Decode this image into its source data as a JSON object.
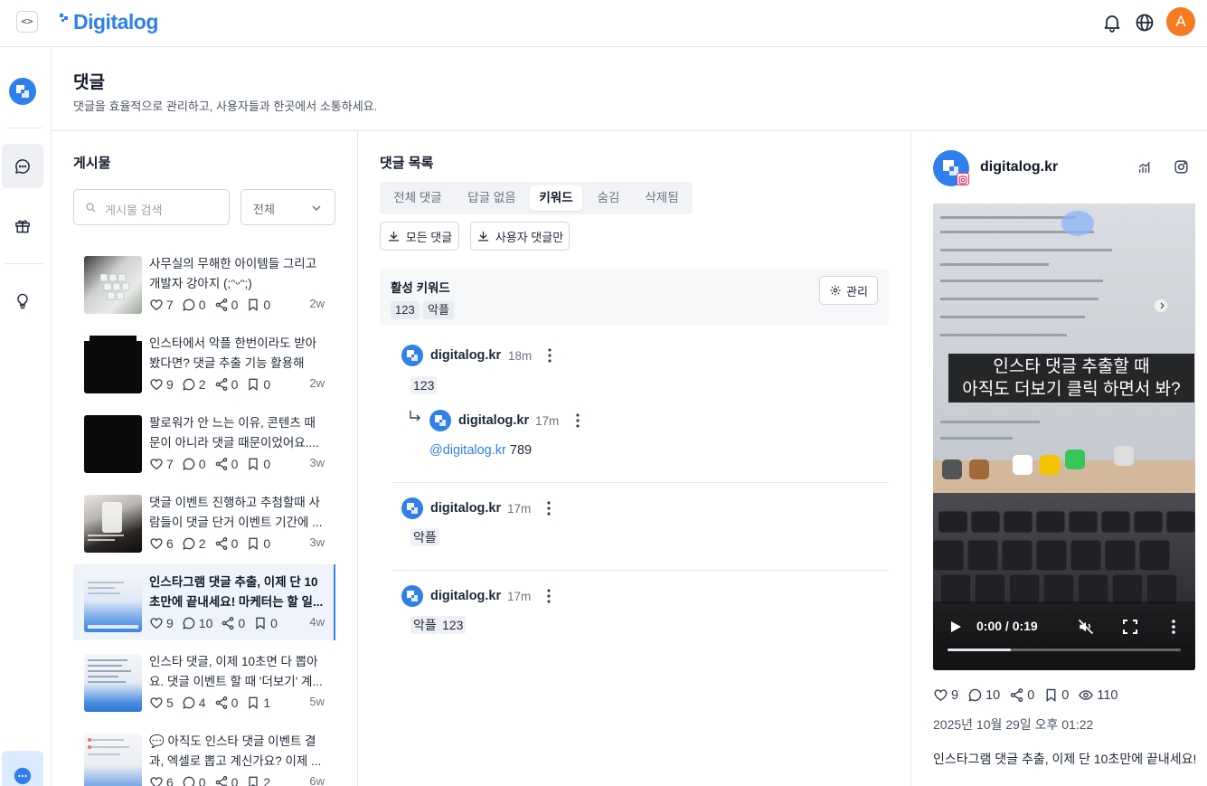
{
  "topbar": {
    "toggle_label": "<>",
    "logo_text": "Digitalog",
    "avatar_letter": "A",
    "icons": [
      "bell-icon",
      "globe-icon"
    ],
    "brand_color": "#2f80ed",
    "avatar_color": "#f47c20"
  },
  "rail": {
    "items": [
      "logo",
      "chat-icon",
      "gift-icon",
      "lightbulb-icon"
    ],
    "active": "chat-icon"
  },
  "page": {
    "title": "댓글",
    "subtitle": "댓글을 효율적으로 관리하고, 사용자들과 한곳에서 소통하세요."
  },
  "posts": {
    "title": "게시물",
    "search_placeholder": "게시물 검색",
    "filter_value": "전체",
    "items": [
      {
        "text": "사무실의 무해한 아이템들 그리고 개발자 강아지 (;ᵔᵕᵔ;)",
        "likes": "7",
        "comments": "0",
        "shares": "0",
        "saves": "0",
        "age": "2w",
        "selected": false
      },
      {
        "text": "인스타에서 악플 한번이라도 받아봤다면? 댓글 추출 기능 활용해보...",
        "likes": "9",
        "comments": "2",
        "shares": "0",
        "saves": "0",
        "age": "2w",
        "selected": false
      },
      {
        "text": "팔로워가 안 느는 이유, 콘텐츠 때문이 아니라 댓글 때문이었어요....",
        "likes": "7",
        "comments": "0",
        "shares": "0",
        "saves": "0",
        "age": "3w",
        "selected": false
      },
      {
        "text": "댓글 이벤트 진행하고 추첨할때 사람들이 댓글 단거 이벤트 기간에 ...",
        "likes": "6",
        "comments": "2",
        "shares": "0",
        "saves": "0",
        "age": "3w",
        "selected": false
      },
      {
        "text": "인스타그램 댓글 추출, 이제 단 10초만에 끝내세요! 마케터는 할 일...",
        "likes": "9",
        "comments": "10",
        "shares": "0",
        "saves": "0",
        "age": "4w",
        "selected": true
      },
      {
        "text": "인스타 댓글, 이제 10초면 다 뽑아요. 댓글 이벤트 할 때 '더보기' 계...",
        "likes": "5",
        "comments": "4",
        "shares": "0",
        "saves": "1",
        "age": "5w",
        "selected": false
      },
      {
        "text": "💬 아직도 인스타 댓글 이벤트 결과, 엑셀로 뽑고 계신가요? 이제 ...",
        "likes": "6",
        "comments": "0",
        "shares": "0",
        "saves": "2",
        "age": "6w",
        "selected": false
      }
    ]
  },
  "comments": {
    "title": "댓글 목록",
    "tabs": [
      "전체 댓글",
      "답글 없음",
      "키워드",
      "숨김",
      "삭제됨"
    ],
    "active_tab": "키워드",
    "download_all": "모든 댓글",
    "download_user": "사용자 댓글만",
    "keywords": {
      "title": "활성 키워드",
      "manage_label": "관리",
      "chips": [
        "123",
        "악플"
      ]
    },
    "threads": [
      {
        "author": "digitalog.kr",
        "time": "18m",
        "chips": [
          "123"
        ],
        "reply": {
          "author": "digitalog.kr",
          "time": "17m",
          "mention": "@digitalog.kr",
          "text": "789"
        }
      },
      {
        "author": "digitalog.kr",
        "time": "17m",
        "chips": [
          "악플"
        ]
      },
      {
        "author": "digitalog.kr",
        "time": "17m",
        "chips": [
          "악플",
          "123"
        ]
      }
    ]
  },
  "post_detail": {
    "account": "digitalog.kr",
    "video_caption_line1": "인스타 댓글 추출할 때",
    "video_caption_line2": "아직도 더보기 클릭 하면서 봐?",
    "video_time": "0:00 / 0:19",
    "video_progress": 0.27,
    "likes": "9",
    "comments": "10",
    "shares": "0",
    "saves": "0",
    "views": "110",
    "date": "2025년 10월 29일 오후 01:22",
    "caption": "인스타그램 댓글 추출, 이제 단 10초만에 끝내세요!"
  }
}
